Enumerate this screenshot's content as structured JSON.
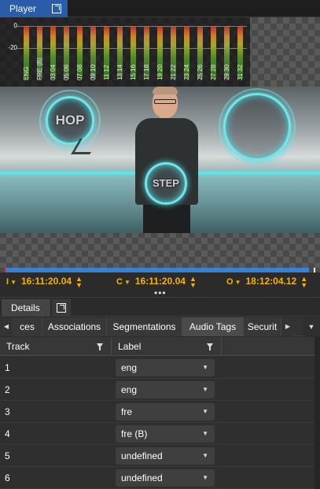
{
  "player": {
    "tab_label": "Player",
    "popout_icon": "popout-icon"
  },
  "meter": {
    "scale": [
      "0",
      "-20"
    ],
    "channels": [
      "ENG",
      "FRE (B)",
      "03 04",
      "05 06",
      "07 08",
      "09 10",
      "11 12",
      "13 14",
      "15 16",
      "17 18",
      "19 20",
      "21 22",
      "23 24",
      "25 26",
      "27 28",
      "29 30",
      "31 32"
    ]
  },
  "video": {
    "hop_text": "HOP",
    "step_text": "STEP"
  },
  "timeline": {
    "progress": 0.98
  },
  "timecodes": {
    "in": {
      "prefix": "I",
      "value": "16:11:20.04"
    },
    "current": {
      "prefix": "C",
      "value": "16:11:20.04"
    },
    "out": {
      "prefix": "O",
      "value": "18:12:04.12"
    }
  },
  "splitter_dots": "•••",
  "details": {
    "tab_label": "Details",
    "popout_icon": "popout-icon"
  },
  "subtabs": {
    "items": [
      "ces",
      "Associations",
      "Segmentations",
      "Audio Tags",
      "Securit"
    ],
    "active": "Audio Tags",
    "left_arrow": "◀",
    "right_arrow": "▶",
    "menu_caret": "▼"
  },
  "table": {
    "headers": {
      "track": "Track",
      "label": "Label"
    },
    "rows": [
      {
        "track": "1",
        "label": "eng"
      },
      {
        "track": "2",
        "label": "eng"
      },
      {
        "track": "3",
        "label": "fre"
      },
      {
        "track": "4",
        "label": "fre (B)"
      },
      {
        "track": "5",
        "label": "undefined"
      },
      {
        "track": "6",
        "label": "undefined"
      }
    ],
    "caret": "▼"
  },
  "colors": {
    "accent_blue": "#2a5caa",
    "timecode": "#f5b301",
    "timeline_fill": "#3a7fd6",
    "glow_cyan": "#5fe4e8"
  }
}
